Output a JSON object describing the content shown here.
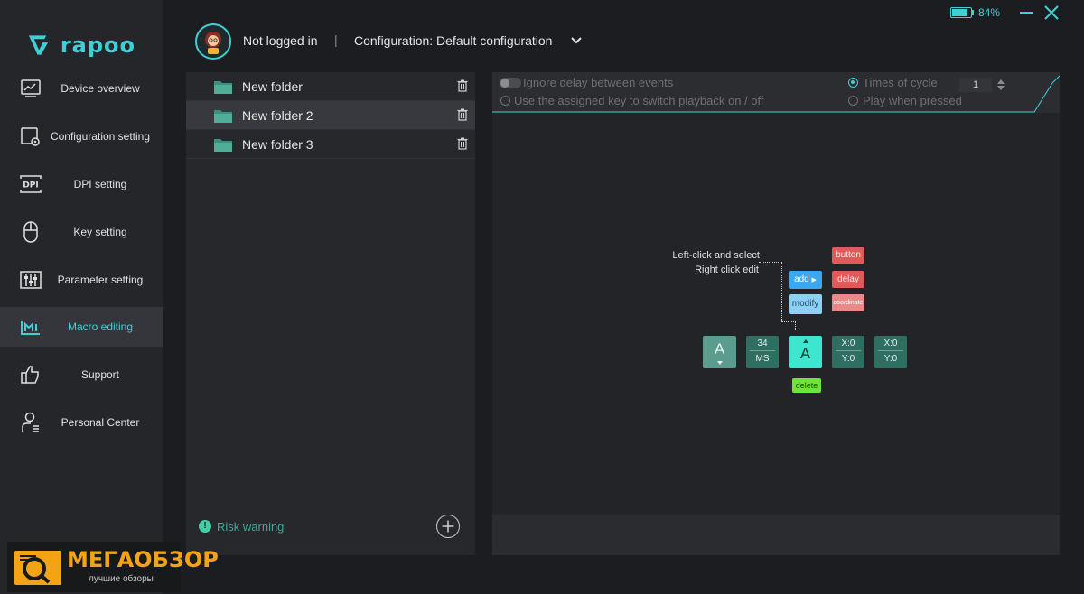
{
  "app": {
    "brand": "rapoo"
  },
  "sidebar": {
    "items": [
      {
        "label": "Device overview",
        "icon": "monitor-chart-icon"
      },
      {
        "label": "Configuration setting",
        "icon": "config-gear-icon"
      },
      {
        "label": "DPI setting",
        "icon": "dpi-icon"
      },
      {
        "label": "Key setting",
        "icon": "mouse-icon"
      },
      {
        "label": "Parameter setting",
        "icon": "sliders-icon"
      },
      {
        "label": "Macro editing",
        "icon": "macro-icon",
        "active": true
      },
      {
        "label": "Support",
        "icon": "thumbs-up-icon"
      },
      {
        "label": "Personal Center",
        "icon": "user-icon"
      }
    ]
  },
  "header": {
    "login_status": "Not logged in",
    "separator": "|",
    "configuration": "Configuration: Default configuration"
  },
  "status": {
    "battery_pct": "84%",
    "battery_level": 0.84
  },
  "folders": {
    "items": [
      {
        "label": "New folder"
      },
      {
        "label": "New folder 2",
        "selected": true
      },
      {
        "label": "New folder 3"
      }
    ],
    "risk_warning": "Risk warning",
    "risk_glyph": "!"
  },
  "macro": {
    "options": {
      "ignore_delay": "Ignore delay between events",
      "assigned_key": "Use the assigned key to switch playback on / off",
      "times_of_cycle": "Times of cycle",
      "play_when_pressed": "Play when pressed",
      "cycle_value": "1"
    },
    "tutorial": {
      "line1": "Left-click and select",
      "line2": "Right click edit",
      "chips": {
        "button": "button",
        "delay": "delay",
        "coordinate": "coordinate",
        "add": "add",
        "modify": "modify",
        "delete": "delete"
      },
      "blocks": [
        {
          "letter": "A"
        },
        {
          "top": "34",
          "bottom": "MS"
        },
        {
          "letter": "A"
        },
        {
          "top": "X:0",
          "bottom": "Y:0"
        },
        {
          "top": "X:0",
          "bottom": "Y:0"
        }
      ]
    }
  },
  "watermark": {
    "title": "МЕГАОБЗОР",
    "subtitle": "лучшие обзоры"
  },
  "colors": {
    "accent": "#3fd0d6",
    "background": "#1b1d20",
    "panel": "#26282c"
  }
}
